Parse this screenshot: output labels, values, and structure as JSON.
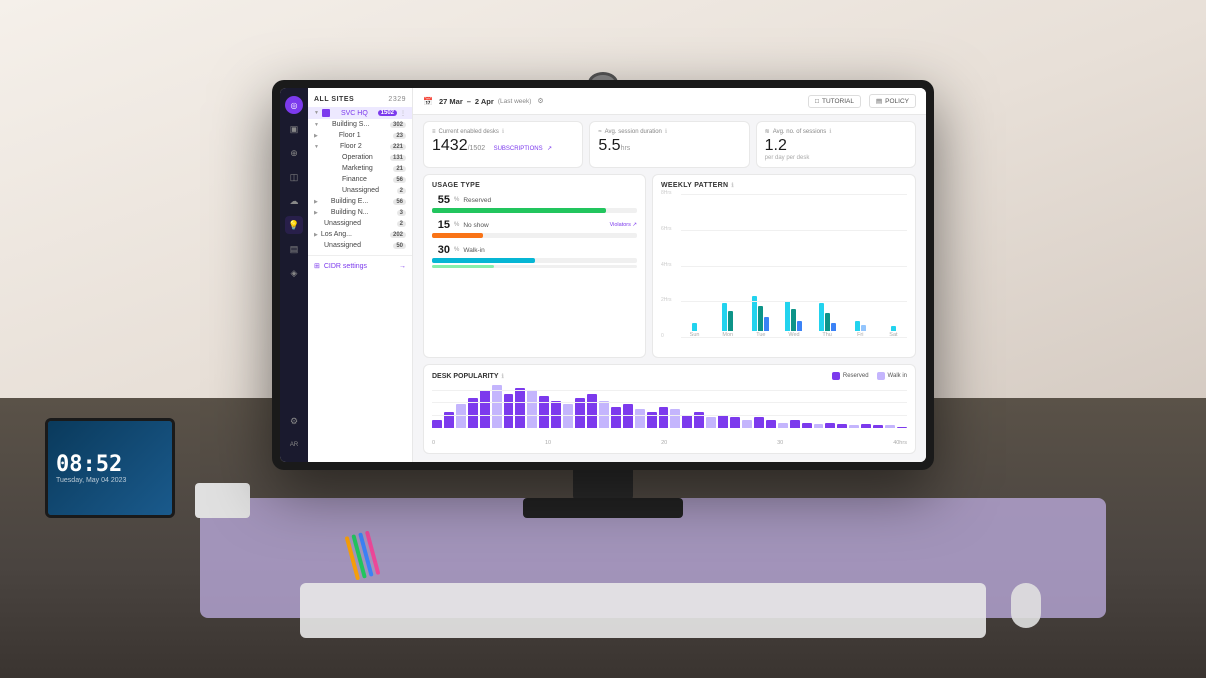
{
  "colors": {
    "accent": "#7c3aed",
    "green": "#22c55e",
    "orange": "#f97316",
    "teal": "#06b6d4",
    "lightGreen": "#86efac",
    "cyan": "#22d3ee",
    "blue": "#3b82f6",
    "purple": "#7c3aed",
    "lightPurple": "#c4b5fd"
  },
  "topbar": {
    "dateStart": "27 Mar",
    "dateEnd": "2 Apr",
    "dateTag": "(Last week)",
    "tutorial_label": "TUTORIAL",
    "policy_label": "POLICY"
  },
  "stats": [
    {
      "label": "Current enabled desks",
      "value": "1432",
      "sub": "/1502",
      "link": "SUBSCRIPTIONS",
      "icon": "desk-icon"
    },
    {
      "label": "Avg. session duration",
      "value": "5.5",
      "unit": "hrs",
      "sub": ""
    },
    {
      "label": "Avg. no. of sessions",
      "value": "1.2",
      "unit": "",
      "sub": "per day per desk"
    }
  ],
  "sidebar": {
    "all_sites_label": "ALL SITES",
    "all_sites_count": "2329",
    "items": [
      {
        "name": "SVC HQ",
        "count": "1502",
        "level": 1,
        "active": true,
        "hasIcon": true
      },
      {
        "name": "Building S...",
        "count": "302",
        "level": 2
      },
      {
        "name": "Floor 1",
        "count": "23",
        "level": 3
      },
      {
        "name": "Floor 2",
        "count": "221",
        "level": 3,
        "expanded": true
      },
      {
        "name": "Operation",
        "count": "131",
        "level": 4
      },
      {
        "name": "Marketing",
        "count": "21",
        "level": 4
      },
      {
        "name": "Finance",
        "count": "56",
        "level": 4
      },
      {
        "name": "Unassigned",
        "count": "2",
        "level": 4
      },
      {
        "name": "Building E...",
        "count": "56",
        "level": 2
      },
      {
        "name": "Building N...",
        "count": "3",
        "level": 2
      },
      {
        "name": "Unassigned",
        "count": "2",
        "level": 2
      },
      {
        "name": "Los Ang...",
        "count": "202",
        "level": 1
      },
      {
        "name": "Unassigned",
        "count": "50",
        "level": 2
      }
    ],
    "cidr_label": "CIDR settings"
  },
  "usageType": {
    "title": "USAGE TYPE",
    "items": [
      {
        "pct": "55",
        "label": "Reserved",
        "barWidth": 85,
        "color": "green"
      },
      {
        "pct": "15",
        "label": "No show",
        "barWidth": 25,
        "color": "orange",
        "hasViolators": true
      },
      {
        "pct": "30",
        "label": "Walk-in",
        "barWidth": 50,
        "color": "teal"
      }
    ],
    "violators_label": "Violators"
  },
  "weeklyPattern": {
    "title": "WEEKLY PATTERN",
    "yLabels": [
      "8 Hrs",
      "6 Hrs",
      "4 Hrs",
      "2 Hrs",
      "0"
    ],
    "days": [
      {
        "label": "Sun",
        "bars": [
          {
            "h": 10,
            "color": "cyan"
          },
          {
            "h": 6,
            "color": "teal-dark"
          }
        ]
      },
      {
        "label": "Mon",
        "bars": [
          {
            "h": 28,
            "color": "cyan"
          },
          {
            "h": 22,
            "color": "teal-dark"
          },
          {
            "h": 12,
            "color": "blue"
          }
        ]
      },
      {
        "label": "Tue",
        "bars": [
          {
            "h": 32,
            "color": "cyan"
          },
          {
            "h": 25,
            "color": "teal-dark"
          },
          {
            "h": 15,
            "color": "blue"
          }
        ]
      },
      {
        "label": "Wed",
        "bars": [
          {
            "h": 30,
            "color": "cyan"
          },
          {
            "h": 20,
            "color": "teal-dark"
          },
          {
            "h": 10,
            "color": "blue"
          }
        ]
      },
      {
        "label": "Thu",
        "bars": [
          {
            "h": 28,
            "color": "cyan"
          },
          {
            "h": 18,
            "color": "teal-dark"
          },
          {
            "h": 8,
            "color": "blue"
          }
        ]
      },
      {
        "label": "Fri",
        "bars": [
          {
            "h": 8,
            "color": "cyan"
          },
          {
            "h": 6,
            "color": "small-blue"
          }
        ]
      },
      {
        "label": "Sat",
        "bars": [
          {
            "h": 4,
            "color": "cyan"
          }
        ]
      }
    ]
  },
  "deskPopularity": {
    "title": "DESK POPULARITY",
    "legend": [
      {
        "label": "Reserved",
        "color": "#7c3aed"
      },
      {
        "label": "Walk in",
        "color": "#c4b5fd"
      }
    ],
    "xLabels": [
      "0",
      "10",
      "20",
      "30",
      "40hrs"
    ],
    "bars": [
      6,
      12,
      18,
      22,
      28,
      32,
      25,
      30,
      28,
      24,
      20,
      18,
      22,
      25,
      20,
      16,
      18,
      14,
      12,
      16,
      14,
      10,
      12,
      8,
      10,
      8,
      6,
      8,
      6,
      4,
      6,
      4,
      3,
      4,
      3,
      2,
      3,
      2,
      2,
      1
    ]
  },
  "laptop": {
    "time": "08:52",
    "date": "Tuesday, May 04 2023"
  },
  "railIcons": [
    "●",
    "▣",
    "⊕",
    "◫",
    "☁",
    "💡",
    "▤",
    "◈",
    "⚙",
    "AR"
  ]
}
